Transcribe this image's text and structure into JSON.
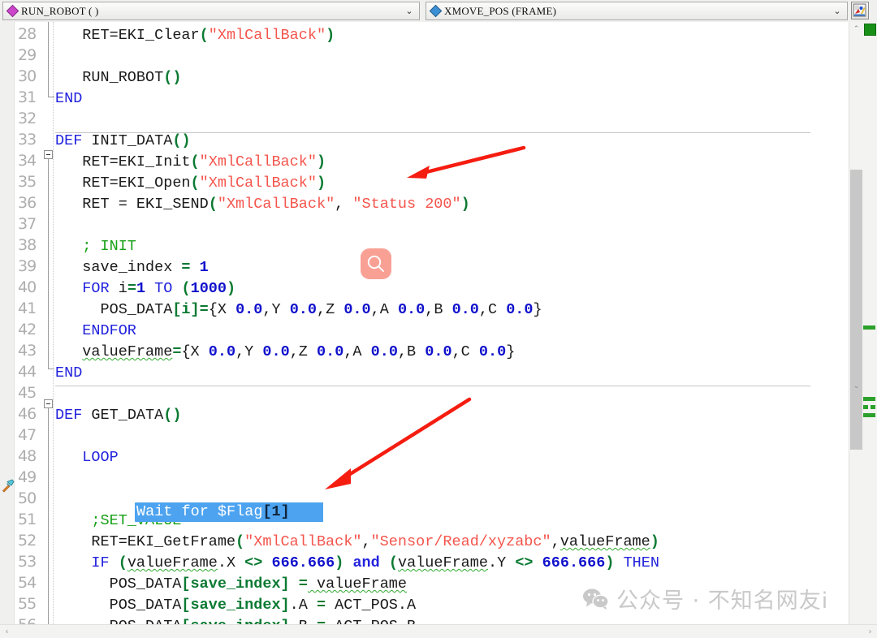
{
  "toolbar": {
    "left_combo": {
      "icon": "diamond-magenta-icon",
      "label": "RUN_ROBOT (  )",
      "caret": "⌄"
    },
    "right_combo": {
      "icon": "diamond-blue-icon",
      "label": "XMOVE_POS (FRAME)",
      "caret": "⌄"
    },
    "palette_button": {
      "icon": "color-palette-icon",
      "tooltip": ""
    }
  },
  "editor": {
    "first_line": 28,
    "lines": [
      {
        "n": 28,
        "indent": 3,
        "tokens": [
          {
            "t": "RET=EKI_Clear",
            "c": "plain"
          },
          {
            "t": "(",
            "c": "punc"
          },
          {
            "t": "\"XmlCallBack\"",
            "c": "str"
          },
          {
            "t": ")",
            "c": "punc"
          }
        ]
      },
      {
        "n": 29,
        "indent": 0,
        "tokens": []
      },
      {
        "n": 30,
        "indent": 3,
        "tokens": [
          {
            "t": "RUN_ROBOT",
            "c": "plain"
          },
          {
            "t": "()",
            "c": "punc"
          }
        ]
      },
      {
        "n": 31,
        "indent": 0,
        "tokens": [
          {
            "t": "END",
            "c": "kw"
          }
        ]
      },
      {
        "n": 32,
        "indent": 0,
        "tokens": []
      },
      {
        "n": 33,
        "indent": 0,
        "tokens": [
          {
            "t": "DEF",
            "c": "kw"
          },
          {
            "t": " INIT_DATA",
            "c": "plain"
          },
          {
            "t": "()",
            "c": "punc"
          }
        ]
      },
      {
        "n": 34,
        "indent": 3,
        "tokens": [
          {
            "t": "RET=EKI_Init",
            "c": "plain"
          },
          {
            "t": "(",
            "c": "punc"
          },
          {
            "t": "\"XmlCallBack\"",
            "c": "str"
          },
          {
            "t": ")",
            "c": "punc"
          }
        ]
      },
      {
        "n": 35,
        "indent": 3,
        "tokens": [
          {
            "t": "RET=EKI_Open",
            "c": "plain"
          },
          {
            "t": "(",
            "c": "punc"
          },
          {
            "t": "\"XmlCallBack\"",
            "c": "str"
          },
          {
            "t": ")",
            "c": "punc"
          }
        ]
      },
      {
        "n": 36,
        "indent": 3,
        "tokens": [
          {
            "t": "RET = EKI_SEND",
            "c": "plain"
          },
          {
            "t": "(",
            "c": "punc"
          },
          {
            "t": "\"XmlCallBack\"",
            "c": "str"
          },
          {
            "t": ", ",
            "c": "plain"
          },
          {
            "t": "\"Status 200\"",
            "c": "str"
          },
          {
            "t": ")",
            "c": "punc"
          }
        ]
      },
      {
        "n": 37,
        "indent": 0,
        "tokens": []
      },
      {
        "n": 38,
        "indent": 3,
        "tokens": [
          {
            "t": "; INIT",
            "c": "cmt"
          }
        ]
      },
      {
        "n": 39,
        "indent": 3,
        "tokens": [
          {
            "t": "save_index ",
            "c": "plain"
          },
          {
            "t": "=",
            "c": "op"
          },
          {
            "t": " ",
            "c": "plain"
          },
          {
            "t": "1",
            "c": "num"
          }
        ]
      },
      {
        "n": 40,
        "indent": 3,
        "tokens": [
          {
            "t": "FOR",
            "c": "kw"
          },
          {
            "t": " i",
            "c": "plain"
          },
          {
            "t": "=",
            "c": "op"
          },
          {
            "t": "1",
            "c": "num"
          },
          {
            "t": " ",
            "c": "plain"
          },
          {
            "t": "TO",
            "c": "kw"
          },
          {
            "t": " ",
            "c": "plain"
          },
          {
            "t": "(",
            "c": "punc"
          },
          {
            "t": "1000",
            "c": "num"
          },
          {
            "t": ")",
            "c": "punc"
          }
        ]
      },
      {
        "n": 41,
        "indent": 5,
        "tokens": [
          {
            "t": "POS_DATA",
            "c": "plain"
          },
          {
            "t": "[i]",
            "c": "punc"
          },
          {
            "t": "=",
            "c": "op"
          },
          {
            "t": "{X ",
            "c": "plain"
          },
          {
            "t": "0.0",
            "c": "num"
          },
          {
            "t": ",Y ",
            "c": "plain"
          },
          {
            "t": "0.0",
            "c": "num"
          },
          {
            "t": ",Z ",
            "c": "plain"
          },
          {
            "t": "0.0",
            "c": "num"
          },
          {
            "t": ",A ",
            "c": "plain"
          },
          {
            "t": "0.0",
            "c": "num"
          },
          {
            "t": ",B ",
            "c": "plain"
          },
          {
            "t": "0.0",
            "c": "num"
          },
          {
            "t": ",C ",
            "c": "plain"
          },
          {
            "t": "0.0",
            "c": "num"
          },
          {
            "t": "}",
            "c": "plain"
          }
        ]
      },
      {
        "n": 42,
        "indent": 3,
        "tokens": [
          {
            "t": "ENDFOR",
            "c": "kw"
          }
        ]
      },
      {
        "n": 43,
        "indent": 3,
        "tokens": [
          {
            "t": "valueFrame",
            "c": "plain squig"
          },
          {
            "t": "=",
            "c": "op"
          },
          {
            "t": "{X ",
            "c": "plain"
          },
          {
            "t": "0.0",
            "c": "num"
          },
          {
            "t": ",Y ",
            "c": "plain"
          },
          {
            "t": "0.0",
            "c": "num"
          },
          {
            "t": ",Z ",
            "c": "plain"
          },
          {
            "t": "0.0",
            "c": "num"
          },
          {
            "t": ",A ",
            "c": "plain"
          },
          {
            "t": "0.0",
            "c": "num"
          },
          {
            "t": ",B ",
            "c": "plain"
          },
          {
            "t": "0.0",
            "c": "num"
          },
          {
            "t": ",C ",
            "c": "plain"
          },
          {
            "t": "0.0",
            "c": "num"
          },
          {
            "t": "}",
            "c": "plain"
          }
        ]
      },
      {
        "n": 44,
        "indent": 0,
        "tokens": [
          {
            "t": "END",
            "c": "kw"
          }
        ]
      },
      {
        "n": 45,
        "indent": 0,
        "tokens": []
      },
      {
        "n": 46,
        "indent": 0,
        "tokens": [
          {
            "t": "DEF",
            "c": "kw"
          },
          {
            "t": " GET_DATA",
            "c": "plain"
          },
          {
            "t": "()",
            "c": "punc"
          }
        ]
      },
      {
        "n": 47,
        "indent": 0,
        "tokens": []
      },
      {
        "n": 48,
        "indent": 3,
        "tokens": [
          {
            "t": "LOOP",
            "c": "kw"
          }
        ]
      },
      {
        "n": 49,
        "indent": 0,
        "tokens": []
      },
      {
        "n": 50,
        "indent": 5,
        "selected": true,
        "text": "Wait for $Flag",
        "bracket": "[1]"
      },
      {
        "n": 51,
        "indent": 4,
        "tokens": [
          {
            "t": ";SET_VALUE",
            "c": "cmt"
          }
        ]
      },
      {
        "n": 52,
        "indent": 4,
        "tokens": [
          {
            "t": "RET=EKI_GetFrame",
            "c": "plain"
          },
          {
            "t": "(",
            "c": "punc"
          },
          {
            "t": "\"XmlCallBack\"",
            "c": "str"
          },
          {
            "t": ",",
            "c": "plain"
          },
          {
            "t": "\"Sensor/Read/xyzabc\"",
            "c": "str"
          },
          {
            "t": ",",
            "c": "plain"
          },
          {
            "t": "valueFrame",
            "c": "plain squig"
          },
          {
            "t": ")",
            "c": "punc"
          }
        ]
      },
      {
        "n": 53,
        "indent": 4,
        "tokens": [
          {
            "t": "IF",
            "c": "kw"
          },
          {
            "t": " ",
            "c": "plain"
          },
          {
            "t": "(",
            "c": "punc"
          },
          {
            "t": "valueFrame",
            "c": "plain squig"
          },
          {
            "t": ".X ",
            "c": "plain"
          },
          {
            "t": "<>",
            "c": "op"
          },
          {
            "t": " ",
            "c": "plain"
          },
          {
            "t": "666.666",
            "c": "num"
          },
          {
            "t": ")",
            "c": "punc"
          },
          {
            "t": " ",
            "c": "plain"
          },
          {
            "t": "and",
            "c": "kw2"
          },
          {
            "t": " ",
            "c": "plain"
          },
          {
            "t": "(",
            "c": "punc"
          },
          {
            "t": "valueFrame",
            "c": "plain squig"
          },
          {
            "t": ".Y ",
            "c": "plain"
          },
          {
            "t": "<>",
            "c": "op"
          },
          {
            "t": " ",
            "c": "plain"
          },
          {
            "t": "666.666",
            "c": "num"
          },
          {
            "t": ")",
            "c": "punc"
          },
          {
            "t": " ",
            "c": "plain"
          },
          {
            "t": "THEN",
            "c": "kw"
          }
        ]
      },
      {
        "n": 54,
        "indent": 6,
        "tokens": [
          {
            "t": "POS_DATA",
            "c": "plain"
          },
          {
            "t": "[save_index]",
            "c": "punc"
          },
          {
            "t": " ",
            "c": "plain"
          },
          {
            "t": "=",
            "c": "op"
          },
          {
            "t": " valueFrame",
            "c": "plain squig"
          }
        ]
      },
      {
        "n": 55,
        "indent": 6,
        "tokens": [
          {
            "t": "POS_DATA",
            "c": "plain"
          },
          {
            "t": "[save_index]",
            "c": "punc"
          },
          {
            "t": ".A ",
            "c": "plain"
          },
          {
            "t": "=",
            "c": "op"
          },
          {
            "t": " ACT_POS.A",
            "c": "plain"
          }
        ]
      },
      {
        "n": 56,
        "indent": 6,
        "tokens": [
          {
            "t": "POS_DATA",
            "c": "plain"
          },
          {
            "t": "[save_index]",
            "c": "punc"
          },
          {
            "t": ".B ",
            "c": "plain"
          },
          {
            "t": "=",
            "c": "op"
          },
          {
            "t": " ACT_POS.B",
            "c": "plain"
          }
        ]
      }
    ],
    "gutter_icons": [
      {
        "line": 50,
        "icon": "hammer-icon"
      }
    ],
    "fold_markers": [
      {
        "line": 33,
        "icon": "fold-collapse-icon"
      },
      {
        "line": 46,
        "icon": "fold-collapse-icon"
      }
    ]
  },
  "annotations": {
    "arrows": [
      {
        "name": "arrow-to-eki-open",
        "color": "#f51c10"
      },
      {
        "name": "arrow-to-wait-for-flag",
        "color": "#f51c10"
      }
    ],
    "search_badge": {
      "icon": "magnifier-icon",
      "color": "#f9a095"
    },
    "watermark": {
      "icon": "wechat-icon",
      "text": "公众号 · 不知名网友i"
    }
  },
  "scrollbars": {
    "vertical": {
      "up_arrow": "⌃",
      "down_arrow": "⌄"
    },
    "horizontal": {
      "left_arrow": "‹",
      "right_arrow": "›"
    },
    "marker_color": "#2ba12b"
  }
}
